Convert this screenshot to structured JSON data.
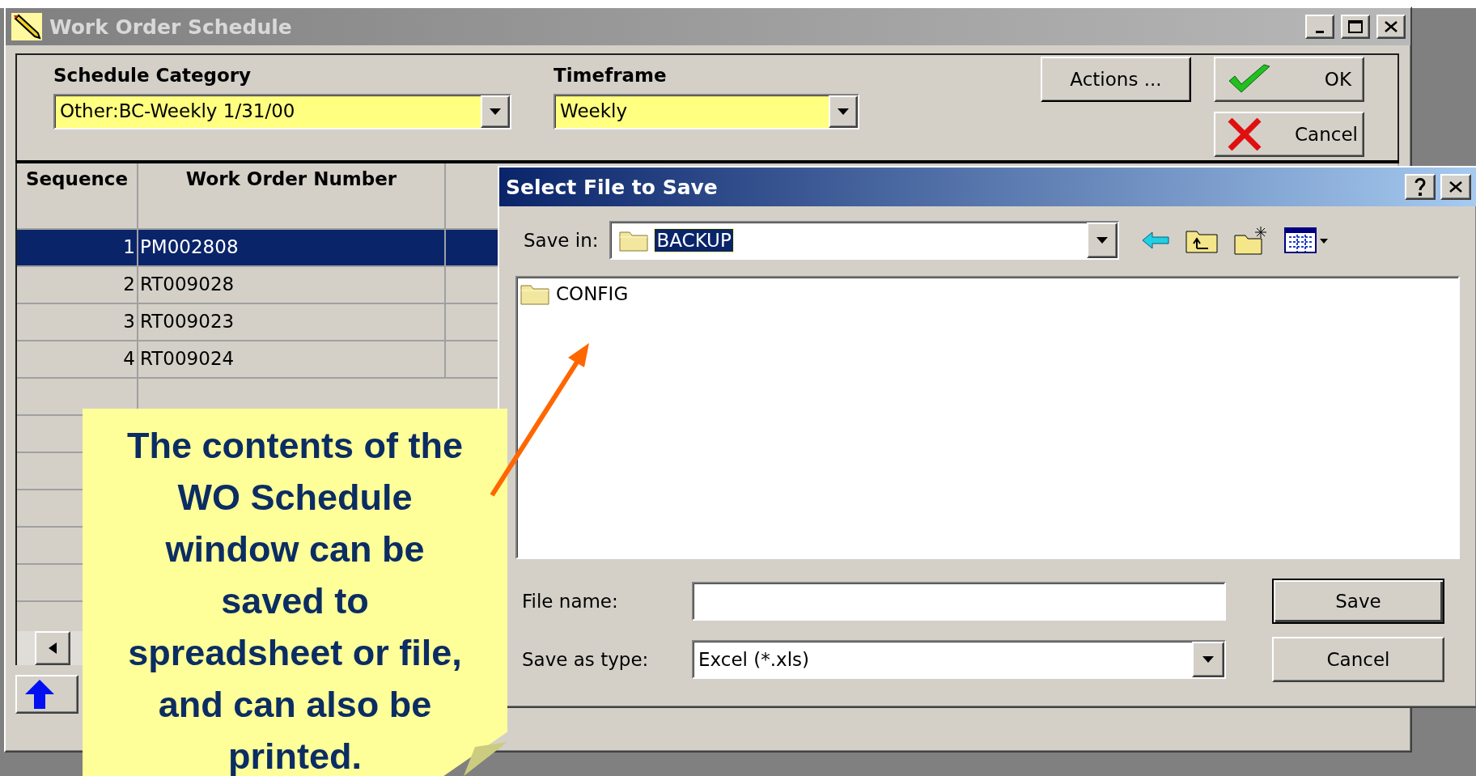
{
  "window": {
    "title": "Work Order Schedule"
  },
  "filters": [
    {
      "label": "Schedule Category",
      "value": "Other:BC-Weekly 1/31/00",
      "kind": "wide"
    },
    {
      "label": "Timeframe",
      "value": "Weekly",
      "kind": "narrow"
    }
  ],
  "buttons": [
    {
      "label": "Actions ...",
      "kind": "plain"
    },
    {
      "label": "OK",
      "kind": "ok"
    },
    {
      "label": "Cancel",
      "kind": "cancel"
    }
  ],
  "table": {
    "columns": [
      "Sequence",
      "Work Order Number"
    ],
    "rows": [
      {
        "sequence": "1",
        "number": "PM002808",
        "selected": true
      },
      {
        "sequence": "2",
        "number": "RT009028",
        "selected": false
      },
      {
        "sequence": "3",
        "number": "RT009023",
        "selected": false
      },
      {
        "sequence": "4",
        "number": "RT009024",
        "selected": false
      }
    ]
  },
  "dialog": {
    "title": "Select File to Save",
    "save_in": {
      "label": "Save in:",
      "value": "BACKUP"
    },
    "files": [
      {
        "name": "CONFIG"
      }
    ],
    "file_name": {
      "label": "File name:"
    },
    "save_as_type": {
      "label": "Save as type:",
      "value": "Excel (*.xls)"
    },
    "buttons": [
      {
        "label": "Save",
        "default": true
      },
      {
        "label": "Cancel",
        "default": false
      }
    ]
  },
  "callout": {
    "text": "The contents of the WO Schedule window can be saved to spreadsheet or file, and can also be printed."
  }
}
